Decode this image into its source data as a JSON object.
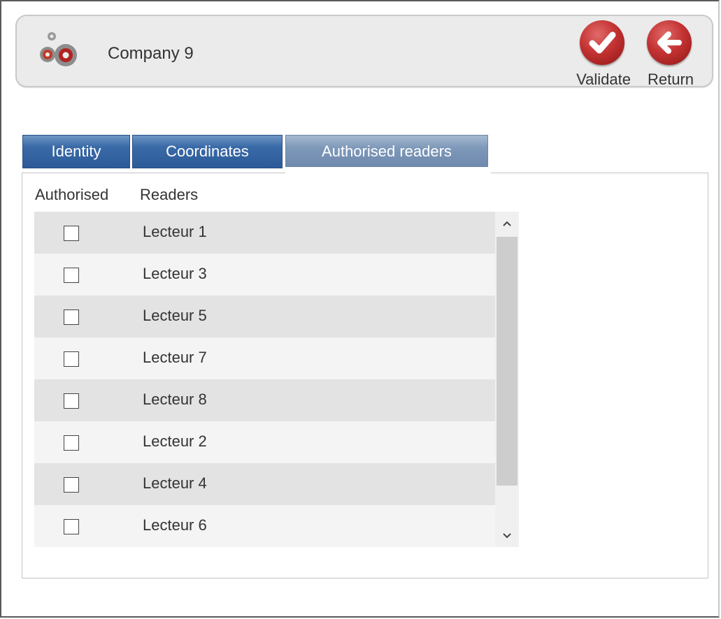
{
  "header": {
    "company_name": "Company 9",
    "app_icon": "gears-icon",
    "validate_label": "Validate",
    "return_label": "Return",
    "accent_color": "#c43333"
  },
  "tabs": [
    {
      "label": "Identity",
      "active": false
    },
    {
      "label": "Coordinates",
      "active": false
    },
    {
      "label": "Authorised readers",
      "active": true
    }
  ],
  "readers_table": {
    "columns": [
      "Authorised",
      "Readers"
    ],
    "rows": [
      {
        "authorised": false,
        "reader": "Lecteur 1"
      },
      {
        "authorised": false,
        "reader": "Lecteur 3"
      },
      {
        "authorised": false,
        "reader": "Lecteur 5"
      },
      {
        "authorised": false,
        "reader": "Lecteur 7"
      },
      {
        "authorised": false,
        "reader": "Lecteur 8"
      },
      {
        "authorised": false,
        "reader": "Lecteur 2"
      },
      {
        "authorised": false,
        "reader": "Lecteur 4"
      },
      {
        "authorised": false,
        "reader": "Lecteur 6"
      }
    ]
  },
  "colors": {
    "tab_inactive": "#2c5a98",
    "tab_active": "#7e98b9",
    "row_odd": "#e3e3e3",
    "row_even": "#f4f4f4"
  }
}
